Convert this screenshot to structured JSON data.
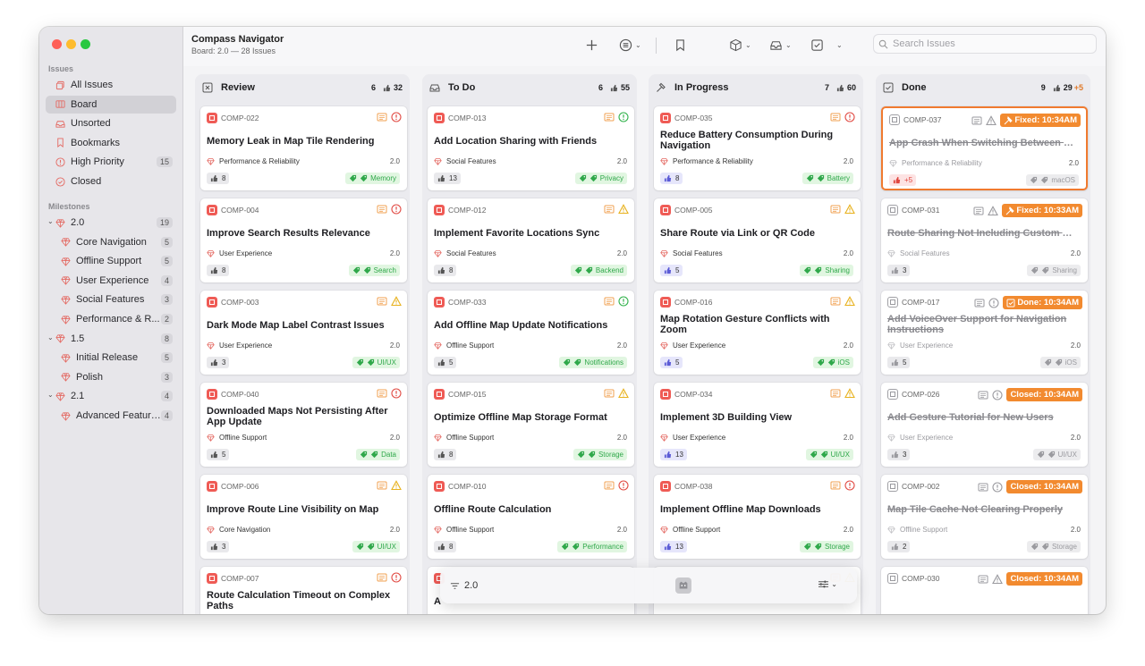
{
  "window": {
    "title": "Compass Navigator",
    "subtitle": "Board: 2.0 — 28 Issues"
  },
  "search": {
    "placeholder": "Search Issues"
  },
  "sidebar": {
    "issues_header": "Issues",
    "issues": [
      {
        "label": "All Issues",
        "icon": "stack-icon"
      },
      {
        "label": "Board",
        "icon": "board-icon",
        "active": true
      },
      {
        "label": "Unsorted",
        "icon": "inbox-icon"
      },
      {
        "label": "Bookmarks",
        "icon": "bookmark-icon"
      },
      {
        "label": "High Priority",
        "icon": "alert-circle-icon",
        "count": "15"
      },
      {
        "label": "Closed",
        "icon": "check-circle-icon"
      }
    ],
    "milestones_header": "Milestones",
    "milestones": [
      {
        "label": "2.0",
        "count": "19",
        "group": true
      },
      {
        "label": "Core Navigation",
        "count": "5"
      },
      {
        "label": "Offline Support",
        "count": "5"
      },
      {
        "label": "User Experience",
        "count": "4"
      },
      {
        "label": "Social Features",
        "count": "3"
      },
      {
        "label": "Performance & R...",
        "count": "2"
      },
      {
        "label": "1.5",
        "count": "8",
        "group": true
      },
      {
        "label": "Initial Release",
        "count": "5"
      },
      {
        "label": "Polish",
        "count": "3"
      },
      {
        "label": "2.1",
        "count": "4",
        "group": true
      },
      {
        "label": "Advanced Features",
        "count": "4"
      }
    ]
  },
  "columns": [
    {
      "name": "Review",
      "count": "6",
      "points": "32",
      "extra": "",
      "cards": [
        {
          "key": "COMP-022",
          "title": "Memory Leak in Map Tile Rendering",
          "milestone": "Performance & Reliability",
          "version": "2.0",
          "points": "8",
          "tag": "Memory",
          "flag": "red"
        },
        {
          "key": "COMP-004",
          "title": "Improve Search Results Relevance",
          "milestone": "User Experience",
          "version": "2.0",
          "points": "8",
          "tag": "Search",
          "flag": "red"
        },
        {
          "key": "COMP-003",
          "title": "Dark Mode Map Label Contrast Issues",
          "milestone": "User Experience",
          "version": "2.0",
          "points": "3",
          "tag": "UI/UX",
          "flag": "warn"
        },
        {
          "key": "COMP-040",
          "title": "Downloaded Maps Not Persisting After App Update",
          "milestone": "Offline Support",
          "version": "2.0",
          "points": "5",
          "tag": "Data",
          "flag": "red"
        },
        {
          "key": "COMP-006",
          "title": "Improve Route Line Visibility on Map",
          "milestone": "Core Navigation",
          "version": "2.0",
          "points": "3",
          "tag": "UI/UX",
          "flag": "warn"
        },
        {
          "key": "COMP-007",
          "title": "Route Calculation Timeout on Complex Paths",
          "milestone": "",
          "version": "",
          "points": "",
          "tag": "",
          "flag": "red"
        }
      ]
    },
    {
      "name": "To Do",
      "count": "6",
      "points": "55",
      "extra": "",
      "cards": [
        {
          "key": "COMP-013",
          "title": "Add Location Sharing with Friends",
          "milestone": "Social Features",
          "version": "2.0",
          "points": "13",
          "tag": "Privacy",
          "flag": "green"
        },
        {
          "key": "COMP-012",
          "title": "Implement Favorite Locations Sync",
          "milestone": "Social Features",
          "version": "2.0",
          "points": "8",
          "tag": "Backend",
          "flag": "warn"
        },
        {
          "key": "COMP-033",
          "title": "Add Offline Map Update Notifications",
          "milestone": "Offline Support",
          "version": "2.0",
          "points": "5",
          "tag": "Notifications",
          "flag": "green"
        },
        {
          "key": "COMP-015",
          "title": "Optimize Offline Map Storage Format",
          "milestone": "Offline Support",
          "version": "2.0",
          "points": "8",
          "tag": "Storage",
          "flag": "warn"
        },
        {
          "key": "COMP-010",
          "title": "Offline Route Calculation",
          "milestone": "Offline Support",
          "version": "2.0",
          "points": "8",
          "tag": "Performance",
          "flag": "red"
        },
        {
          "key": "",
          "title": "A",
          "milestone": "",
          "version": "",
          "points": "",
          "tag": "",
          "flag": "none"
        }
      ]
    },
    {
      "name": "In Progress",
      "count": "7",
      "points": "60",
      "extra": "",
      "cards": [
        {
          "key": "COMP-035",
          "title": "Reduce Battery Consumption During Navigation",
          "milestone": "Performance & Reliability",
          "version": "2.0",
          "points": "8",
          "tag": "Battery",
          "flag": "red"
        },
        {
          "key": "COMP-005",
          "title": "Share Route via Link or QR Code",
          "milestone": "Social Features",
          "version": "2.0",
          "points": "5",
          "tag": "Sharing",
          "flag": "warn"
        },
        {
          "key": "COMP-016",
          "title": "Map Rotation Gesture Conflicts with Zoom",
          "milestone": "User Experience",
          "version": "2.0",
          "points": "5",
          "tag": "iOS",
          "flag": "warn"
        },
        {
          "key": "COMP-034",
          "title": "Implement 3D Building View",
          "milestone": "User Experience",
          "version": "2.0",
          "points": "13",
          "tag": "UI/UX",
          "flag": "warn"
        },
        {
          "key": "COMP-038",
          "title": "Implement Offline Map Downloads",
          "milestone": "Offline Support",
          "version": "2.0",
          "points": "13",
          "tag": "Storage",
          "flag": "red"
        },
        {
          "key": "",
          "title": "",
          "milestone": "",
          "version": "",
          "points": "",
          "tag": "",
          "flag": "warn"
        }
      ]
    },
    {
      "name": "Done",
      "count": "9",
      "points": "29",
      "extra": "+5",
      "cards": [
        {
          "key": "COMP-037",
          "title": "App Crash When Switching Between Rou...",
          "milestone": "Performance & Reliability",
          "version": "2.0",
          "points": "+5",
          "tag": "macOS",
          "stamp": "Fixed: 10:34AM",
          "stamp_icon": "hammer-icon",
          "flag": "warn"
        },
        {
          "key": "COMP-031",
          "title": "Route Sharing Not Including Custom Wa...",
          "milestone": "Social Features",
          "version": "2.0",
          "points": "3",
          "tag": "Sharing",
          "stamp": "Fixed: 10:33AM",
          "stamp_icon": "hammer-icon",
          "flag": "warn"
        },
        {
          "key": "COMP-017",
          "title": "Add VoiceOver Support for Navigation Instructions",
          "milestone": "User Experience",
          "version": "2.0",
          "points": "5",
          "tag": "iOS",
          "stamp": "Done: 10:34AM",
          "stamp_icon": "checkbox-icon",
          "flag": "info"
        },
        {
          "key": "COMP-026",
          "title": "Add Gesture Tutorial for New Users",
          "milestone": "User Experience",
          "version": "2.0",
          "points": "3",
          "tag": "UI/UX",
          "stamp": "Closed: 10:34AM",
          "stamp_icon": "",
          "flag": "info"
        },
        {
          "key": "COMP-002",
          "title": "Map Tile Cache Not Clearing Properly",
          "milestone": "Offline Support",
          "version": "2.0",
          "points": "2",
          "tag": "Storage",
          "stamp": "Closed: 10:34AM",
          "stamp_icon": "",
          "flag": "info"
        },
        {
          "key": "COMP-030",
          "title": "",
          "milestone": "",
          "version": "",
          "points": "",
          "tag": "",
          "stamp": "Closed: 10:34AM",
          "stamp_icon": "",
          "flag": "warn"
        }
      ]
    }
  ],
  "bottombar": {
    "filter": "2.0"
  },
  "colors": {
    "accent": "#f28a2f",
    "issue_red": "#ef5b55",
    "tag_green": "#2fa84a",
    "warn_yellow": "#e8b21f"
  }
}
